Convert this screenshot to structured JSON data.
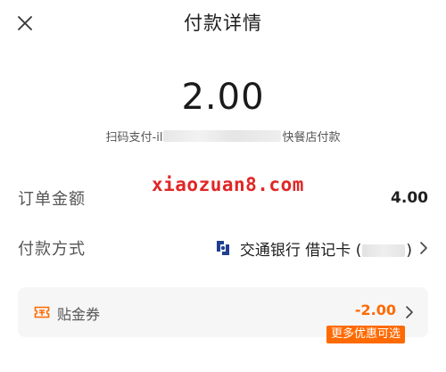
{
  "header": {
    "title": "付款详情",
    "close_icon": "close-icon"
  },
  "payment": {
    "amount": "2.00",
    "merchant_prefix": "扫码支付-il",
    "merchant_suffix": "快餐店付款"
  },
  "details": {
    "order_amount_label": "订单金额",
    "order_amount_value": "4.00",
    "pay_method_label": "付款方式",
    "pay_method_value": "交通银行 借记卡 (",
    "pay_method_close": ")"
  },
  "watermark": "xiaozuan8.com",
  "coupon": {
    "label": "贴金券",
    "value": "-2.00",
    "more_badge": "更多优惠可选"
  },
  "colors": {
    "accent": "#ff6a00",
    "watermark": "#e02626",
    "bank_logo": "#1f3f8f"
  }
}
